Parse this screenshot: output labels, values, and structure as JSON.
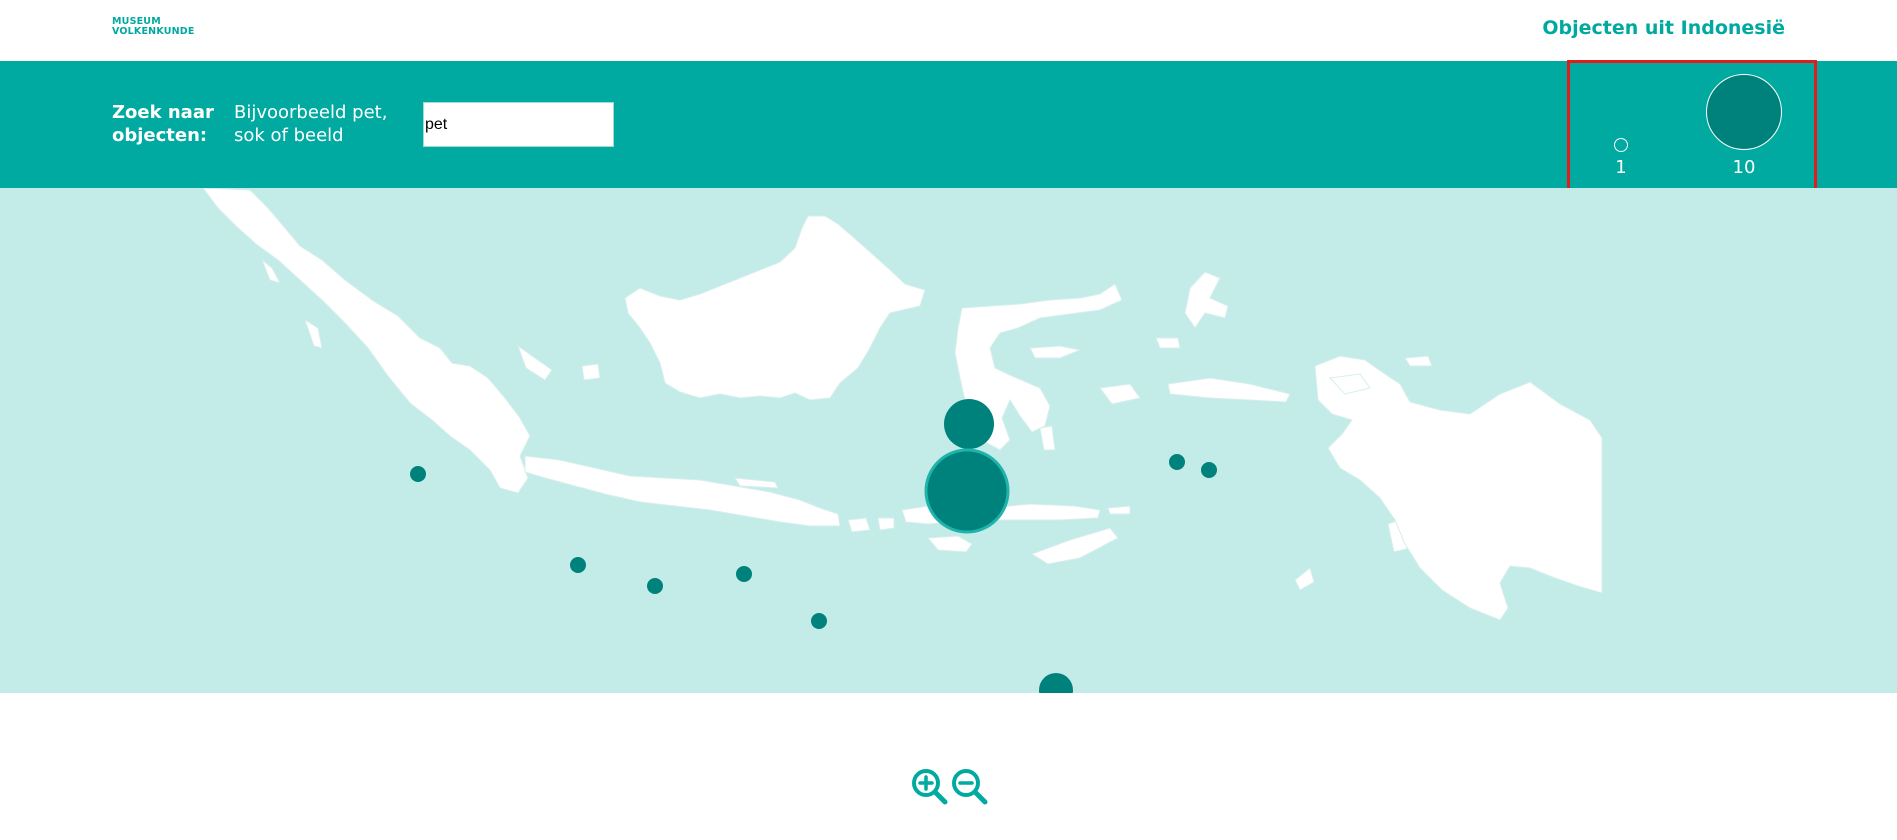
{
  "header": {
    "logo_line1": "MUSEUM",
    "logo_line2": "VOLKENKUNDE",
    "title": "Objecten uit Indonesië"
  },
  "search": {
    "label": "Zoek naar objecten:",
    "hint": "Bijvoorbeeld pet, sok of beeld",
    "value": "pet"
  },
  "legend": {
    "min_label": "1",
    "max_label": "10"
  },
  "colors": {
    "accent": "#00aaa1",
    "marker": "#00827c",
    "sea": "#c3ebe8",
    "land": "#ffffff",
    "highlight": "#e41b1b"
  },
  "icons": {
    "zoom_in": "zoom-in-icon",
    "zoom_out": "zoom-out-icon"
  }
}
